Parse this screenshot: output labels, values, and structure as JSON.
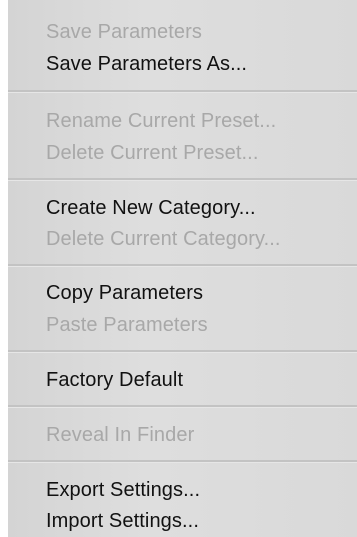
{
  "menu": {
    "items": [
      {
        "label": "Save Parameters",
        "enabled": false
      },
      {
        "label": "Save Parameters As...",
        "enabled": true
      },
      {
        "label": "Rename Current Preset...",
        "enabled": false
      },
      {
        "label": "Delete Current Preset...",
        "enabled": false
      },
      {
        "label": "Create New Category...",
        "enabled": true
      },
      {
        "label": "Delete Current Category...",
        "enabled": false
      },
      {
        "label": "Copy Parameters",
        "enabled": true
      },
      {
        "label": "Paste Parameters",
        "enabled": false
      },
      {
        "label": "Factory Default",
        "enabled": true
      },
      {
        "label": "Reveal In Finder",
        "enabled": false
      },
      {
        "label": "Export Settings...",
        "enabled": true
      },
      {
        "label": "Import Settings...",
        "enabled": true
      }
    ]
  },
  "colors": {
    "enabled_text": "#111111",
    "disabled_text": "#a8a8a8"
  }
}
